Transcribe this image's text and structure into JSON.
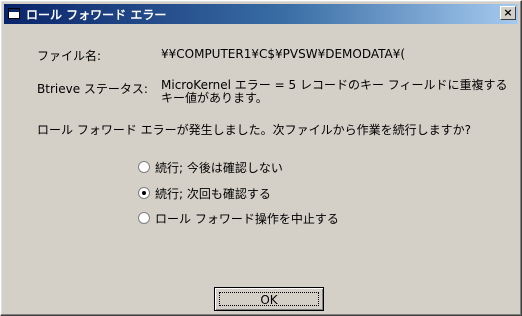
{
  "window": {
    "title": "ロール フォワード エラー",
    "close_glyph": "×"
  },
  "info": {
    "file_label": "ファイル名:",
    "file_value": "¥¥COMPUTER1¥C$¥PVSW¥DEMODATA¥(",
    "status_label": "Btrieve ステータス:",
    "status_line1": "MicroKernel エラー = 5  レコードのキー フィールドに重複する",
    "status_line2": "キー値があります。"
  },
  "question": "ロール フォワード エラーが発生しました。次ファイルから作業を続行しますか?",
  "options": [
    {
      "label": "続行; 今後は確認しない",
      "checked": false
    },
    {
      "label": "続行; 次回も確認する",
      "checked": true
    },
    {
      "label": "ロール フォワード操作を中止する",
      "checked": false
    }
  ],
  "ok_label": "OK"
}
